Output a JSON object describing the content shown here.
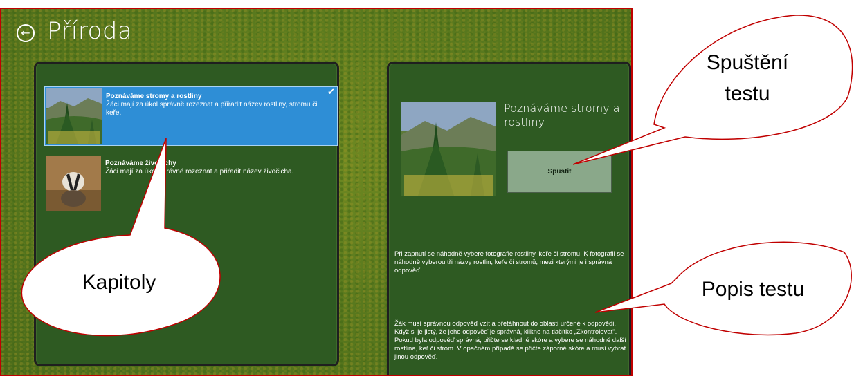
{
  "app": {
    "title": "Příroda",
    "back_icon": "arrow-left-circle-icon"
  },
  "chapters": [
    {
      "title": "Poznáváme stromy a rostliny",
      "description": "Žáci mají za úkol správně rozeznat a přiřadit název rostliny, stromu či keře.",
      "selected": true,
      "image": "forest-image"
    },
    {
      "title": "Poznáváme živočichy",
      "description": "Žáci mají za úkol správně rozeznat a přiřadit název živočicha.",
      "selected": false,
      "image": "badger-image"
    }
  ],
  "detail": {
    "title": "Poznáváme stromy a rostliny",
    "start_label": "Spustit",
    "description_1": "Při zapnutí se náhodně vybere fotografie rostliny, keře či stromu. K fotografii se náhodně vyberou tři názvy rostlin, keře či stromů, mezi kterými je i správná odpověď.",
    "description_2_line1": "Žák musí správnou odpověď vzít a přetáhnout do oblasti určené k odpovědi.",
    "description_2_line2": "Když si je jistý, že jeho odpověď je správná, klikne na tlačítko „Zkontrolovat\". Pokud byla odpověď správná, přičte se kladné skóre a vybere se náhodně další rostlina, keř či strom. V opačném případě se přičte záporné skóre a musí vybrat jinou odpověď."
  },
  "callouts": {
    "kapitoly": "Kapitoly",
    "spusteni_line1": "Spuštění",
    "spusteni_line2": "testu",
    "popis": "Popis testu"
  },
  "colors": {
    "frame": "#c00000",
    "panel": "#2e5a22",
    "selected": "#2e8ed6",
    "button": "#8aa88a"
  }
}
